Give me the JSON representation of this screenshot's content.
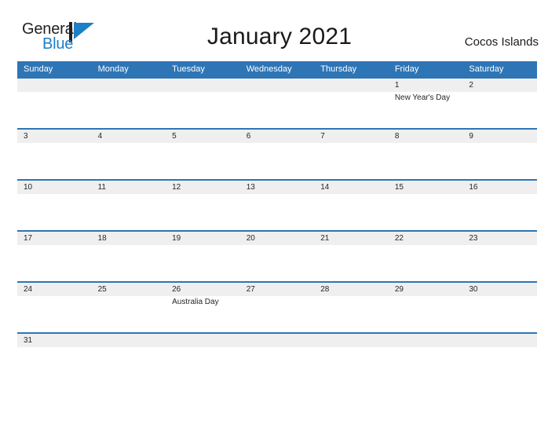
{
  "brand": {
    "name_part1": "General",
    "name_part2": "Blue",
    "flag_icon": "flag-triangle-icon",
    "accent_color": "#1d7fc4"
  },
  "header": {
    "title": "January 2021",
    "locale": "Cocos Islands"
  },
  "theme": {
    "header_blue": "#2e75b6",
    "band_gray": "#efefef",
    "text_dark": "#262626"
  },
  "calendar": {
    "weekdays": [
      "Sunday",
      "Monday",
      "Tuesday",
      "Wednesday",
      "Thursday",
      "Friday",
      "Saturday"
    ],
    "weeks": [
      [
        {
          "date": "",
          "event": ""
        },
        {
          "date": "",
          "event": ""
        },
        {
          "date": "",
          "event": ""
        },
        {
          "date": "",
          "event": ""
        },
        {
          "date": "",
          "event": ""
        },
        {
          "date": "1",
          "event": "New Year's Day"
        },
        {
          "date": "2",
          "event": ""
        }
      ],
      [
        {
          "date": "3",
          "event": ""
        },
        {
          "date": "4",
          "event": ""
        },
        {
          "date": "5",
          "event": ""
        },
        {
          "date": "6",
          "event": ""
        },
        {
          "date": "7",
          "event": ""
        },
        {
          "date": "8",
          "event": ""
        },
        {
          "date": "9",
          "event": ""
        }
      ],
      [
        {
          "date": "10",
          "event": ""
        },
        {
          "date": "11",
          "event": ""
        },
        {
          "date": "12",
          "event": ""
        },
        {
          "date": "13",
          "event": ""
        },
        {
          "date": "14",
          "event": ""
        },
        {
          "date": "15",
          "event": ""
        },
        {
          "date": "16",
          "event": ""
        }
      ],
      [
        {
          "date": "17",
          "event": ""
        },
        {
          "date": "18",
          "event": ""
        },
        {
          "date": "19",
          "event": ""
        },
        {
          "date": "20",
          "event": ""
        },
        {
          "date": "21",
          "event": ""
        },
        {
          "date": "22",
          "event": ""
        },
        {
          "date": "23",
          "event": ""
        }
      ],
      [
        {
          "date": "24",
          "event": ""
        },
        {
          "date": "25",
          "event": ""
        },
        {
          "date": "26",
          "event": "Australia Day"
        },
        {
          "date": "27",
          "event": ""
        },
        {
          "date": "28",
          "event": ""
        },
        {
          "date": "29",
          "event": ""
        },
        {
          "date": "30",
          "event": ""
        }
      ],
      [
        {
          "date": "31",
          "event": ""
        },
        {
          "date": "",
          "event": ""
        },
        {
          "date": "",
          "event": ""
        },
        {
          "date": "",
          "event": ""
        },
        {
          "date": "",
          "event": ""
        },
        {
          "date": "",
          "event": ""
        },
        {
          "date": "",
          "event": ""
        }
      ]
    ]
  }
}
